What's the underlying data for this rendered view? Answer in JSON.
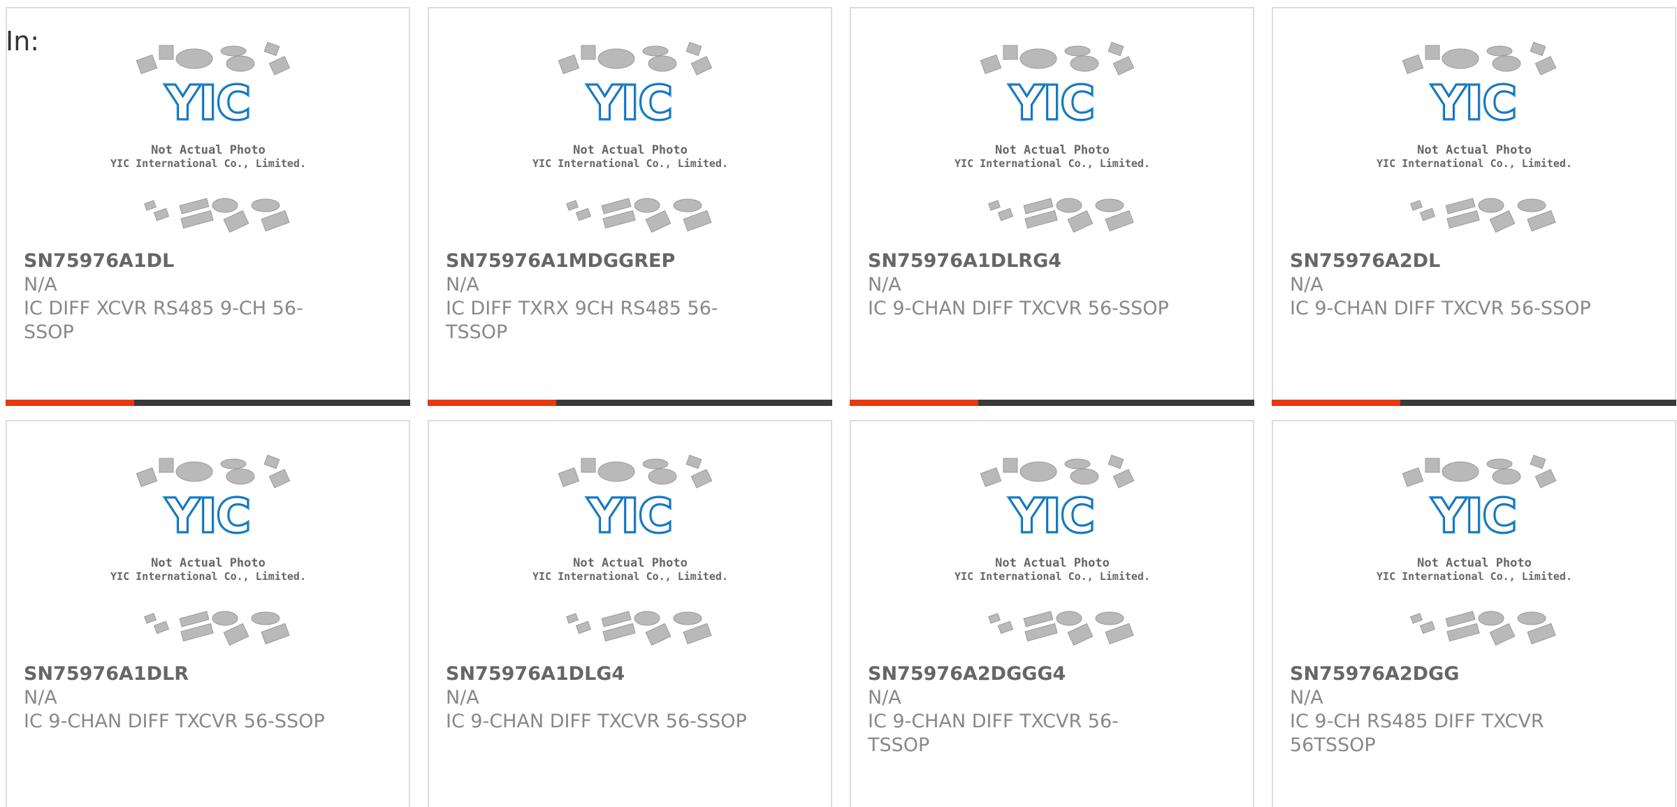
{
  "header": {
    "label": "In:"
  },
  "placeholder": {
    "line1": "Not Actual Photo",
    "line2": "YIC International Co., Limited.",
    "logo_text": "YIC",
    "logo_color": "#1a8cd8"
  },
  "colors": {
    "accent": "#e8380d",
    "bar": "#3a3a3a",
    "border": "#dddddd"
  },
  "products": [
    {
      "part": "SN75976A1DL",
      "manufacturer": "N/A",
      "description": "IC DIFF XCVR RS485 9-CH 56-SSOP"
    },
    {
      "part": "SN75976A1MDGGREP",
      "manufacturer": "N/A",
      "description": "IC DIFF TXRX 9CH RS485 56-TSSOP"
    },
    {
      "part": "SN75976A1DLRG4",
      "manufacturer": "N/A",
      "description": "IC 9-CHAN DIFF TXCVR 56-SSOP"
    },
    {
      "part": "SN75976A2DL",
      "manufacturer": "N/A",
      "description": "IC 9-CHAN DIFF TXCVR 56-SSOP"
    },
    {
      "part": "SN75976A1DLR",
      "manufacturer": "N/A",
      "description": "IC 9-CHAN DIFF TXCVR 56-SSOP"
    },
    {
      "part": "SN75976A1DLG4",
      "manufacturer": "N/A",
      "description": "IC 9-CHAN DIFF TXCVR 56-SSOP"
    },
    {
      "part": "SN75976A2DGGG4",
      "manufacturer": "N/A",
      "description": "IC 9-CHAN DIFF TXCVR 56-TSSOP"
    },
    {
      "part": "SN75976A2DGG",
      "manufacturer": "N/A",
      "description": "IC 9-CH RS485 DIFF TXCVR 56TSSOP"
    }
  ]
}
